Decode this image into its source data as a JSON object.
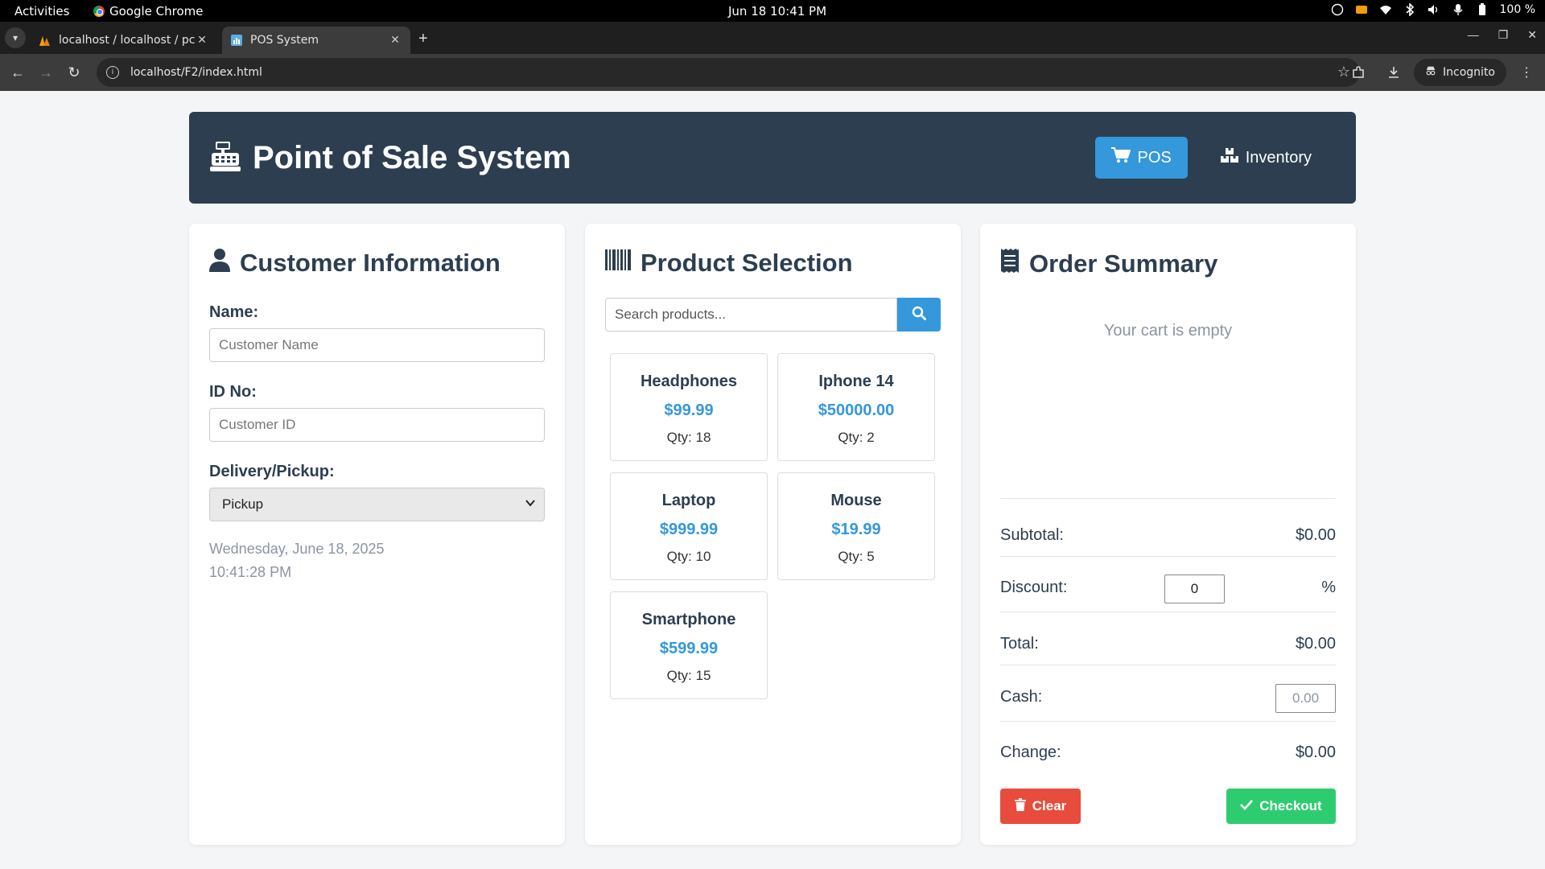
{
  "os": {
    "activities": "Activities",
    "app_name": "Google Chrome",
    "clock": "Jun 18  10:41 PM",
    "battery": "100 %"
  },
  "browser": {
    "tabs": [
      {
        "title": "localhost / localhost / pc",
        "active": false
      },
      {
        "title": "POS System",
        "active": true
      }
    ],
    "url": "localhost/F2/index.html",
    "incognito_label": "Incognito"
  },
  "header": {
    "title": "Point of Sale System",
    "nav": [
      {
        "label": "POS",
        "active": true
      },
      {
        "label": "Inventory",
        "active": false
      }
    ]
  },
  "customer": {
    "heading": "Customer Information",
    "name_label": "Name:",
    "name_placeholder": "Customer Name",
    "id_label": "ID No:",
    "id_placeholder": "Customer ID",
    "delivery_label": "Delivery/Pickup:",
    "delivery_value": "Pickup",
    "date": "Wednesday, June 18, 2025",
    "time": "10:41:28 PM"
  },
  "products": {
    "heading": "Product Selection",
    "search_placeholder": "Search products...",
    "items": [
      {
        "name": "Headphones",
        "price": "$99.99",
        "qty": "Qty: 18"
      },
      {
        "name": "Iphone 14",
        "price": "$50000.00",
        "qty": "Qty: 2"
      },
      {
        "name": "Laptop",
        "price": "$999.99",
        "qty": "Qty: 10"
      },
      {
        "name": "Mouse",
        "price": "$19.99",
        "qty": "Qty: 5"
      },
      {
        "name": "Smartphone",
        "price": "$599.99",
        "qty": "Qty: 15"
      }
    ]
  },
  "order": {
    "heading": "Order Summary",
    "empty_text": "Your cart is empty",
    "subtotal_label": "Subtotal:",
    "subtotal_value": "$0.00",
    "discount_label": "Discount:",
    "discount_value": "0",
    "discount_unit": "%",
    "total_label": "Total:",
    "total_value": "$0.00",
    "cash_label": "Cash:",
    "cash_placeholder": "0.00",
    "change_label": "Change:",
    "change_value": "$0.00",
    "clear_label": "Clear",
    "checkout_label": "Checkout"
  },
  "colors": {
    "header_bg": "#2c3e50",
    "accent": "#3498db",
    "danger": "#e74c3c",
    "success": "#2ecc71"
  }
}
